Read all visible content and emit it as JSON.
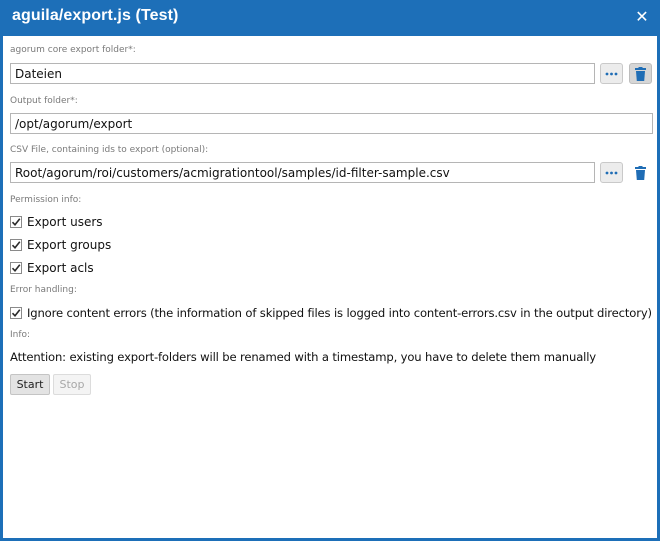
{
  "window": {
    "title": "aguila/export.js (Test)",
    "close_icon": "close-icon"
  },
  "form": {
    "core_folder": {
      "label": "agorum core export folder*:",
      "value": "Dateien"
    },
    "output_folder": {
      "label": "Output folder*:",
      "value": "/opt/agorum/export"
    },
    "csv_file": {
      "label": "CSV File, containing ids to export (optional):",
      "value": "Root/agorum/roi/customers/acmigrationtool/samples/id-filter-sample.csv"
    },
    "permission": {
      "label": "Permission info:",
      "items": [
        {
          "label": "Export users",
          "checked": true
        },
        {
          "label": "Export groups",
          "checked": true
        },
        {
          "label": "Export acls",
          "checked": true
        }
      ]
    },
    "error_handling": {
      "label": "Error handling:",
      "item": {
        "label": "Ignore content errors (the information of skipped files is logged into content-errors.csv in the output directory)",
        "checked": true
      }
    },
    "info": {
      "label": "Info:",
      "text": "Attention: existing export-folders will be renamed with a timestamp, you have to delete them manually"
    }
  },
  "buttons": {
    "start": "Start",
    "stop": "Stop"
  },
  "colors": {
    "accent": "#1d6fb8",
    "icon_blue": "#1f6db5"
  }
}
